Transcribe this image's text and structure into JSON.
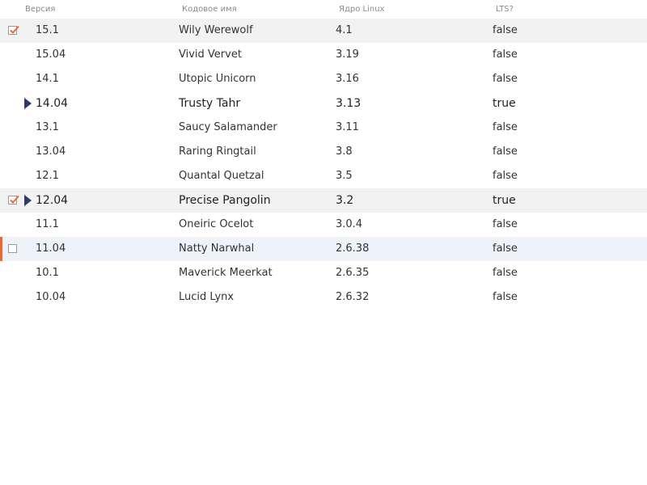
{
  "columns": {
    "version": "Версия",
    "codename": "Кодовое имя",
    "kernel": "Ядро Linux",
    "lts": "LTS?"
  },
  "rows": [
    {
      "version": "15.1",
      "codename": "Wily Werewolf",
      "kernel": "4.1",
      "lts": "false",
      "checked": true,
      "expanded": false,
      "state": "selected"
    },
    {
      "version": "15.04",
      "codename": "Vivid Vervet",
      "kernel": "3.19",
      "lts": "false",
      "checked": false,
      "expanded": false,
      "state": ""
    },
    {
      "version": "14.1",
      "codename": "Utopic Unicorn",
      "kernel": "3.16",
      "lts": "false",
      "checked": false,
      "expanded": false,
      "state": ""
    },
    {
      "version": "14.04",
      "codename": "Trusty Tahr",
      "kernel": "3.13",
      "lts": "true",
      "checked": false,
      "expanded": true,
      "state": ""
    },
    {
      "version": "13.1",
      "codename": "Saucy Salamander",
      "kernel": "3.11",
      "lts": "false",
      "checked": false,
      "expanded": false,
      "state": ""
    },
    {
      "version": "13.04",
      "codename": "Raring Ringtail",
      "kernel": "3.8",
      "lts": "false",
      "checked": false,
      "expanded": false,
      "state": ""
    },
    {
      "version": "12.1",
      "codename": "Quantal Quetzal",
      "kernel": "3.5",
      "lts": "false",
      "checked": false,
      "expanded": false,
      "state": ""
    },
    {
      "version": "12.04",
      "codename": "Precise Pangolin",
      "kernel": "3.2",
      "lts": "true",
      "checked": true,
      "expanded": true,
      "state": "selected"
    },
    {
      "version": "11.1",
      "codename": "Oneiric Ocelot",
      "kernel": "3.0.4",
      "lts": "false",
      "checked": false,
      "expanded": false,
      "state": ""
    },
    {
      "version": "11.04",
      "codename": "Natty Narwhal",
      "kernel": "2.6.38",
      "lts": "false",
      "checked": false,
      "expanded": false,
      "state": "focused",
      "show_checkbox": true
    },
    {
      "version": "10.1",
      "codename": "Maverick Meerkat",
      "kernel": "2.6.35",
      "lts": "false",
      "checked": false,
      "expanded": false,
      "state": ""
    },
    {
      "version": "10.04",
      "codename": "Lucid Lynx",
      "kernel": "2.6.32",
      "lts": "false",
      "checked": false,
      "expanded": false,
      "state": ""
    }
  ],
  "colors": {
    "check": "#f0672c",
    "focus_bar": "#f0672c",
    "expand_icon": "#2d3a66",
    "selected_row": "#f2f2f2",
    "focused_row": "#eef3fa"
  }
}
